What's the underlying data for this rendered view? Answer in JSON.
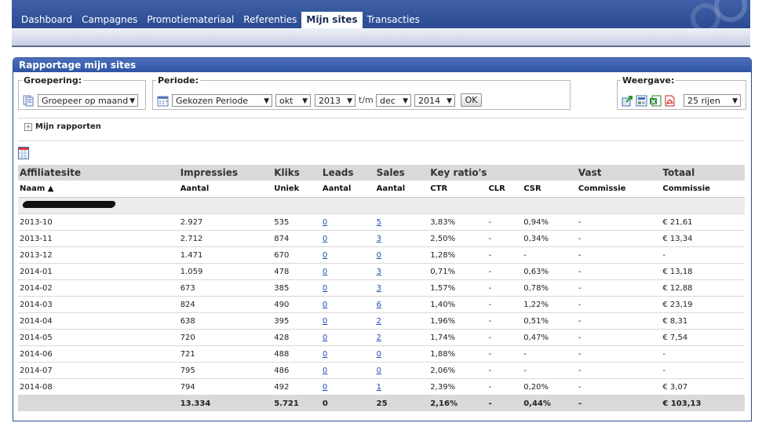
{
  "nav": {
    "tabs": [
      {
        "label": "Dashboard"
      },
      {
        "label": "Campagnes"
      },
      {
        "label": "Promotiemateriaal"
      },
      {
        "label": "Referenties"
      },
      {
        "label": "Mijn sites",
        "active": true
      },
      {
        "label": "Transacties"
      }
    ]
  },
  "panel": {
    "title": "Rapportage mijn sites"
  },
  "filters": {
    "groepering": {
      "legend": "Groepering:",
      "value": "Groepeer op maand"
    },
    "periode": {
      "legend": "Periode:",
      "type": "Gekozen Periode",
      "from_month": "okt",
      "from_year": "2013",
      "separator": "t/m",
      "to_month": "dec",
      "to_year": "2014",
      "ok_label": "OK"
    },
    "weergave": {
      "legend": "Weergave:",
      "rows": "25 rijen"
    }
  },
  "reports_label": "Mijn rapporten",
  "table": {
    "group_headers": [
      "Affiliatesite",
      "Impressies",
      "Kliks",
      "Leads",
      "Sales",
      "Key ratio's",
      "",
      "",
      "Vast",
      "Totaal"
    ],
    "sub_headers": [
      "Naam ▲",
      "Aantal",
      "Uniek",
      "Aantal",
      "Aantal",
      "CTR",
      "CLR",
      "CSR",
      "Commissie",
      "Commissie"
    ],
    "rows": [
      {
        "period": "2013-10",
        "impressies": "2.927",
        "kliks": "535",
        "leads": "0",
        "sales": "5",
        "ctr": "3,83%",
        "clr": "-",
        "csr": "0,94%",
        "vast": "-",
        "totaal": "€ 21,61"
      },
      {
        "period": "2013-11",
        "impressies": "2.712",
        "kliks": "874",
        "leads": "0",
        "sales": "3",
        "ctr": "2,50%",
        "clr": "-",
        "csr": "0,34%",
        "vast": "-",
        "totaal": "€ 13,34"
      },
      {
        "period": "2013-12",
        "impressies": "1.471",
        "kliks": "670",
        "leads": "0",
        "sales": "0",
        "ctr": "1,28%",
        "clr": "-",
        "csr": "-",
        "vast": "-",
        "totaal": "-"
      },
      {
        "period": "2014-01",
        "impressies": "1.059",
        "kliks": "478",
        "leads": "0",
        "sales": "3",
        "ctr": "0,71%",
        "clr": "-",
        "csr": "0,63%",
        "vast": "-",
        "totaal": "€ 13,18"
      },
      {
        "period": "2014-02",
        "impressies": "673",
        "kliks": "385",
        "leads": "0",
        "sales": "3",
        "ctr": "1,57%",
        "clr": "-",
        "csr": "0,78%",
        "vast": "-",
        "totaal": "€ 12,88"
      },
      {
        "period": "2014-03",
        "impressies": "824",
        "kliks": "490",
        "leads": "0",
        "sales": "6",
        "ctr": "1,40%",
        "clr": "-",
        "csr": "1,22%",
        "vast": "-",
        "totaal": "€ 23,19"
      },
      {
        "period": "2014-04",
        "impressies": "638",
        "kliks": "395",
        "leads": "0",
        "sales": "2",
        "ctr": "1,96%",
        "clr": "-",
        "csr": "0,51%",
        "vast": "-",
        "totaal": "€ 8,31"
      },
      {
        "period": "2014-05",
        "impressies": "720",
        "kliks": "428",
        "leads": "0",
        "sales": "2",
        "ctr": "1,74%",
        "clr": "-",
        "csr": "0,47%",
        "vast": "-",
        "totaal": "€ 7,54"
      },
      {
        "period": "2014-06",
        "impressies": "721",
        "kliks": "488",
        "leads": "0",
        "sales": "0",
        "ctr": "1,88%",
        "clr": "-",
        "csr": "-",
        "vast": "-",
        "totaal": "-"
      },
      {
        "period": "2014-07",
        "impressies": "795",
        "kliks": "486",
        "leads": "0",
        "sales": "0",
        "ctr": "2,06%",
        "clr": "-",
        "csr": "-",
        "vast": "-",
        "totaal": "-"
      },
      {
        "period": "2014-08",
        "impressies": "794",
        "kliks": "492",
        "leads": "0",
        "sales": "1",
        "ctr": "2,39%",
        "clr": "-",
        "csr": "0,20%",
        "vast": "-",
        "totaal": "€ 3,07"
      }
    ],
    "totals": {
      "impressies": "13.334",
      "kliks": "5.721",
      "leads": "0",
      "sales": "25",
      "ctr": "2,16%",
      "clr": "-",
      "csr": "0,44%",
      "vast": "-",
      "totaal": "€ 103,13"
    }
  },
  "colors": {
    "nav_blue": "#2b4c93",
    "panel_header": "#3a61b0",
    "link": "#1a4fb5",
    "header_row_gray": "#d9d9d9"
  }
}
